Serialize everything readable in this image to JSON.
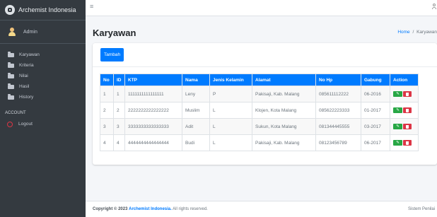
{
  "brand": {
    "name": "Archemist Indonesia"
  },
  "user": {
    "name": "Admin"
  },
  "sidebar": {
    "items": [
      {
        "label": "Karyawan"
      },
      {
        "label": "Kriteria"
      },
      {
        "label": "Nilai"
      },
      {
        "label": "Hasil"
      },
      {
        "label": "History"
      }
    ],
    "account_header": "ACCOUNT",
    "logout_label": "Logout"
  },
  "topbar": {
    "menu_icon": "≡"
  },
  "page": {
    "title": "Karyawan",
    "breadcrumb_home": "Home",
    "breadcrumb_sep": "/",
    "breadcrumb_current": "Karyawan"
  },
  "toolbar": {
    "add_label": "Tambah"
  },
  "table": {
    "headers": [
      "No",
      "ID",
      "KTP",
      "Nama",
      "Jenis Kelamin",
      "Alamat",
      "No Hp",
      "Gabung",
      "Action"
    ],
    "rows": [
      {
        "no": "1",
        "id": "1",
        "ktp": "1111111111111111",
        "nama": "Leny",
        "jk": "P",
        "alamat": "Pakisaji, Kab. Malang",
        "hp": "085611112222",
        "gabung": "06-2016"
      },
      {
        "no": "2",
        "id": "2",
        "ktp": "2222222222222222",
        "nama": "Muslim",
        "jk": "L",
        "alamat": "Klojen, Kota Malang",
        "hp": "085622223333",
        "gabung": "01-2017"
      },
      {
        "no": "3",
        "id": "3",
        "ktp": "3333333333333333",
        "nama": "Adit",
        "jk": "L",
        "alamat": "Sukun, Kota Malang",
        "hp": "081344445555",
        "gabung": "03-2017"
      },
      {
        "no": "4",
        "id": "4",
        "ktp": "4444444444444444",
        "nama": "Budi",
        "jk": "L",
        "alamat": "Pakisaji, Kab. Malang",
        "hp": "08123456789",
        "gabung": "06-2017"
      }
    ],
    "edit_icon": "✎"
  },
  "footer": {
    "copyright_label": "Copyright © 2023",
    "brand": "Archemist Indonesia.",
    "rights": "All rights reserved.",
    "right_text": "Sistem Penilai"
  },
  "colors": {
    "sidebar_bg": "#343a40",
    "primary": "#007bff",
    "success": "#28a745",
    "danger": "#dc3545"
  },
  "icons": {
    "brand": "brand-logo-icon",
    "user": "user-avatar-icon",
    "sidebar": "folder-icon",
    "logout": "power-icon",
    "menu": "hamburger-icon",
    "account": "user-icon",
    "edit": "edit-icon",
    "delete": "trash-icon"
  }
}
